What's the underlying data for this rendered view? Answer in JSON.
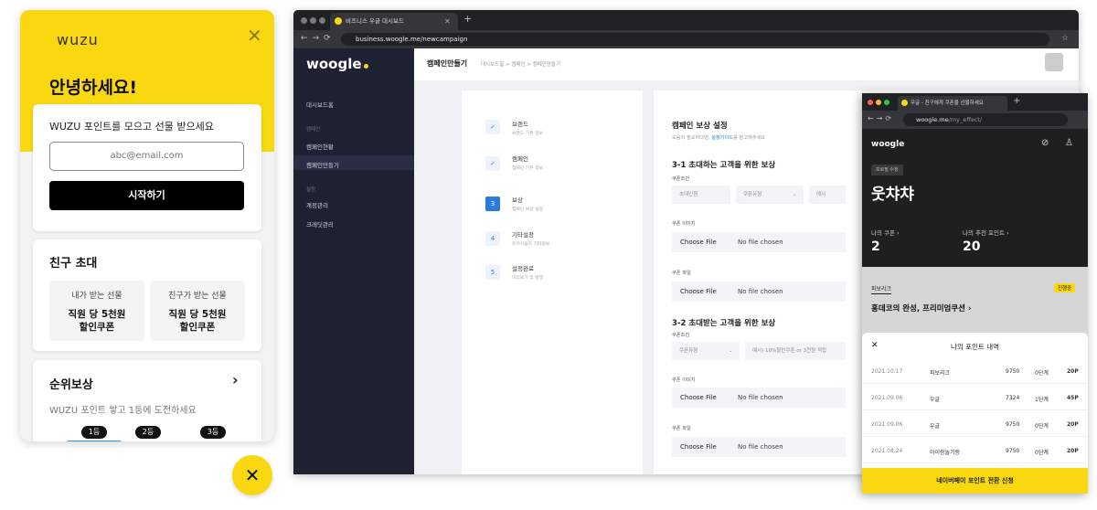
{
  "mobile": {
    "logo": "wuzu",
    "greeting": "안녕하세요!",
    "signup_card": {
      "title": "WUZU 포인트를 모으고 선물 받으세요",
      "email_placeholder": "abc@email.com",
      "start_label": "시작하기"
    },
    "invite_card": {
      "title": "친구 초대",
      "gifts": [
        {
          "label": "내가 받는 선물",
          "value_line1": "직원 당 5천원",
          "value_line2": "할인쿠폰"
        },
        {
          "label": "친구가 받는 선물",
          "value_line1": "직원 당 5천원",
          "value_line2": "할인쿠폰"
        }
      ]
    },
    "rank_card": {
      "title": "순위보상",
      "chevron": "›",
      "subtitle": "WUZU 포인트 쌓고 1등에 도전하세요",
      "ranks": [
        "1등",
        "2등",
        "3등"
      ]
    },
    "fab_label": "✕"
  },
  "browser": {
    "tab_title": "비즈니스 우글 대시보드",
    "url": "business.woogle.me/newcampaign",
    "sidebar": {
      "brand": "woogle",
      "items": [
        {
          "label": "대시보드홈",
          "type": "item"
        },
        {
          "label": "캠페인",
          "type": "section"
        },
        {
          "label": "캠페인현황",
          "type": "item"
        },
        {
          "label": "캠페인만들기",
          "type": "item"
        },
        {
          "label": "설정",
          "type": "section"
        },
        {
          "label": "계정관리",
          "type": "item"
        },
        {
          "label": "크레딧관리",
          "type": "item"
        }
      ]
    },
    "topbar": {
      "title": "캠페인만들기",
      "breadcrumb": "대시보드홈 > 캠페인 > 캠페인만들기"
    },
    "steps": [
      {
        "icon": "✓",
        "state": "done",
        "title": "브랜드",
        "sub": "브랜드 기본 정보"
      },
      {
        "icon": "✓",
        "state": "done",
        "title": "캠페인",
        "sub": "캠페인 기본 정보"
      },
      {
        "icon": "3",
        "state": "current",
        "title": "보상",
        "sub": "캠페인 보상 설정"
      },
      {
        "icon": "4",
        "state": "todo",
        "title": "기타설정",
        "sub": "유저사용자 기타정보"
      },
      {
        "icon": "5",
        "state": "todo",
        "title": "설정완료",
        "sub": "미리보기 및 발행"
      }
    ],
    "form": {
      "title": "캠페인 보상 설정",
      "help_prefix": "도움이 필요하다면,",
      "help_link": "설정가이드",
      "help_suffix": "를 참고해주세요",
      "section1": "3-1 초대하는 고객을 위한 보상",
      "section2": "3-2 초대받는 고객을 위한 보상",
      "coupon_condition": "쿠폰조건",
      "coupon_image": "쿠폰 이미지",
      "coupon_file": "쿠폰 파일",
      "invite_count": "초대인원",
      "coupon_type": "쿠폰유형",
      "example_cut": "예시",
      "example_placeholder": "예시) 10%할인쿠폰 or 3천원 적립",
      "choose_file": "Choose File",
      "no_file": "No file chosen"
    }
  },
  "mobile_browser": {
    "tab_title": "우글 - 친구에게 쿠폰을 선물하세요",
    "url_host": "woogle.me",
    "url_path": "/my_effect/",
    "brand": "woogle",
    "rank_badge": "프로필 수정",
    "username": "웃챠챠",
    "stats": [
      {
        "label": "나의 쿠폰 ›",
        "value": "2"
      },
      {
        "label": "나의 추천 포인트 ›",
        "value": "20"
      }
    ],
    "promo_tag": "피보리크",
    "promo_status": "진행중",
    "promo_title": "홍데코의 완성, 프리미엄쿠션 ›",
    "panel": {
      "close": "✕",
      "title": "나의 포인트 내역",
      "rows": [
        {
          "date": "2021.10.17",
          "brand": "피보리크",
          "n": "9750",
          "level": "0단계",
          "pts": "20P"
        },
        {
          "date": "2021.09.06",
          "brand": "우글",
          "n": "7324",
          "level": "1단계",
          "pts": "45P"
        },
        {
          "date": "2021.09.06",
          "brand": "우글",
          "n": "9750",
          "level": "0단계",
          "pts": "20P"
        },
        {
          "date": "2021.08.24",
          "brand": "아이랑놀기랑",
          "n": "9750",
          "level": "0단계",
          "pts": "20P"
        }
      ],
      "cta": "네이버페이 포인트 전환 신청"
    }
  }
}
